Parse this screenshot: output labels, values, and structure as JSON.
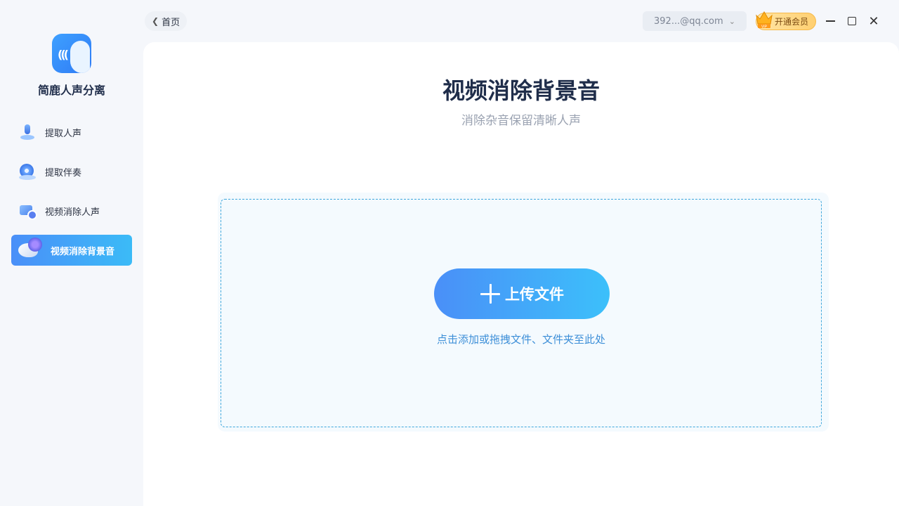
{
  "app": {
    "name": "简鹿人声分离"
  },
  "sidebar": {
    "items": [
      {
        "label": "提取人声",
        "icon": "mic-icon",
        "active": false
      },
      {
        "label": "提取伴奏",
        "icon": "disc-icon",
        "active": false
      },
      {
        "label": "视频消除人声",
        "icon": "video-icon",
        "active": false
      },
      {
        "label": "视频消除背景音",
        "icon": "speaker-icon",
        "active": true
      }
    ]
  },
  "topbar": {
    "back_label": "首页",
    "account": "392...@qq.com",
    "vip_label": "开通会员",
    "vip_badge": "VIP"
  },
  "main": {
    "title": "视频消除背景音",
    "subtitle": "消除杂音保留清晰人声",
    "upload_label": "上传文件",
    "hint": "点击添加或拖拽文件、文件夹至此处"
  },
  "colors": {
    "accent_start": "#4a8ff8",
    "accent_end": "#3cc0fa",
    "hint": "#3d8fd8"
  }
}
